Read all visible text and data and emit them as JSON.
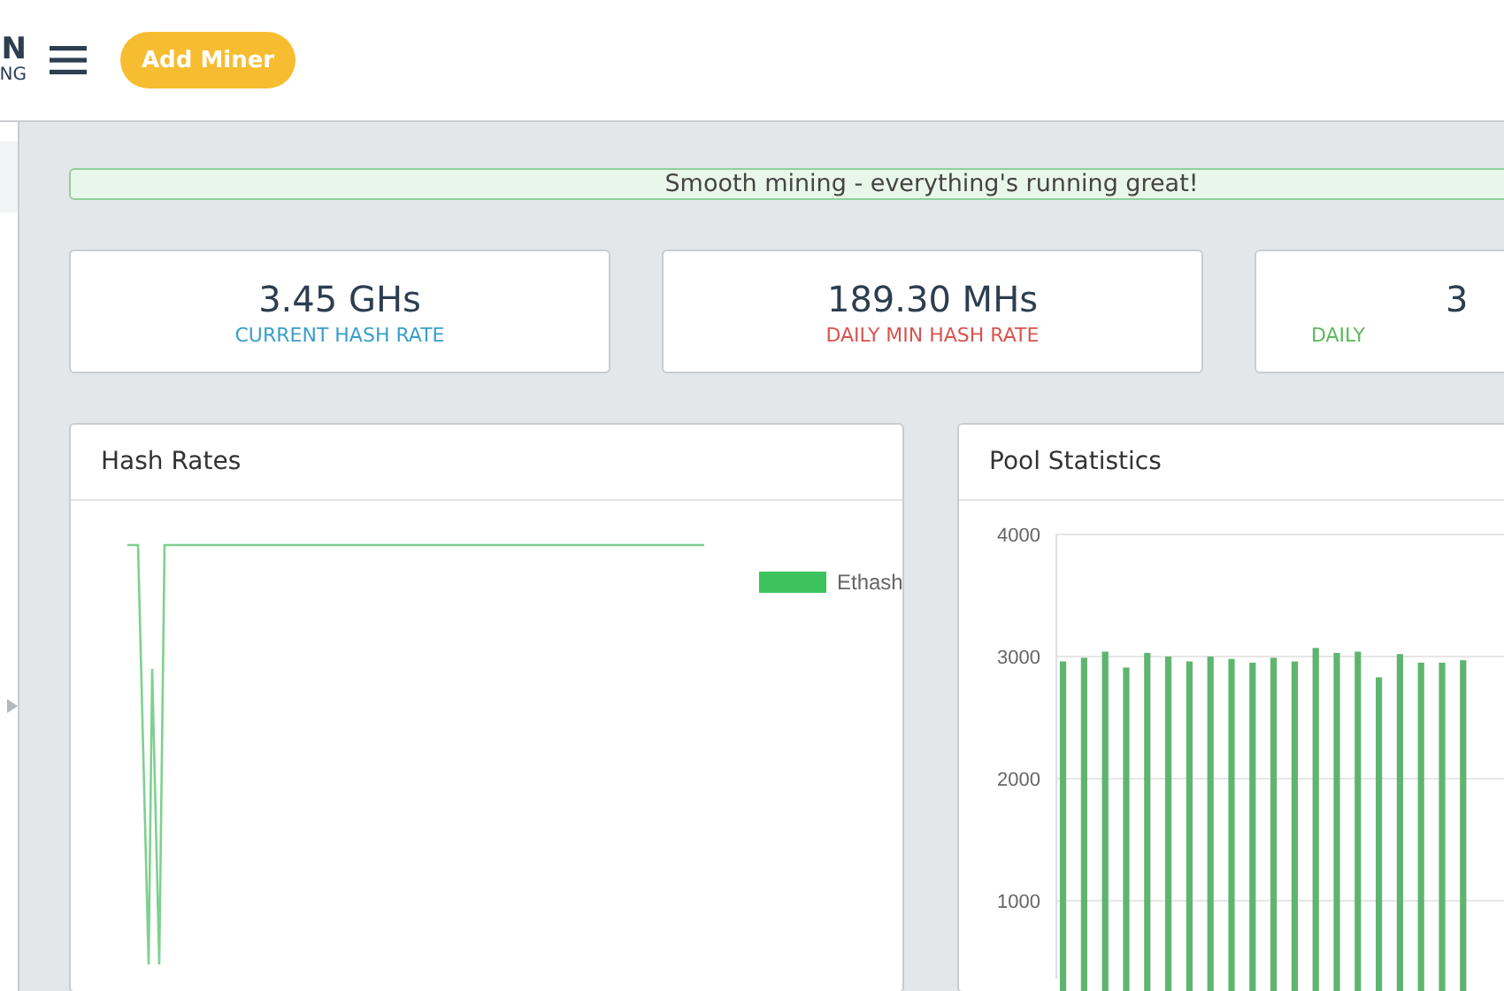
{
  "header": {
    "logo_lines": [
      "N",
      "NG"
    ],
    "add_button": "Add Miner"
  },
  "alert": {
    "text": "Smooth mining - everything's running great!"
  },
  "stats": [
    {
      "value": "3.45 GHs",
      "label": "CURRENT HASH RATE",
      "color": "#3a9fc8"
    },
    {
      "value": "189.30 MHs",
      "label": "DAILY MIN HASH RATE",
      "color": "#d9534f"
    },
    {
      "value": "3",
      "label": "DAILY",
      "color": "#5cb85c"
    }
  ],
  "hash_rates": {
    "title": "Hash Rates",
    "legend": "Ethash"
  },
  "pool_statistics": {
    "title": "Pool Statistics",
    "chart_data": {
      "type": "bar",
      "grid": true,
      "ylim": [
        0,
        4000
      ],
      "yticks": [
        1000,
        2000,
        3000,
        4000
      ],
      "series": [
        {
          "color": "#5fb56f",
          "values": [
            2960,
            2990,
            3040,
            2910,
            3030,
            3000,
            2960,
            3000,
            2980,
            2950,
            2990,
            2960,
            3070,
            3030,
            3040,
            2830,
            3020,
            2950,
            2950,
            2970
          ]
        }
      ]
    }
  }
}
